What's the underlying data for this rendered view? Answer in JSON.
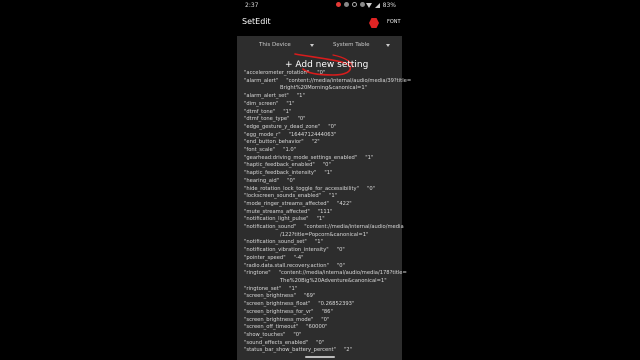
{
  "status_bar": {
    "time": "2:37",
    "battery": "83%"
  },
  "appbar": {
    "title": "SetEdit",
    "font_label": "FONT"
  },
  "dropdowns": {
    "device": "This Device",
    "table": "System Table"
  },
  "add_button": "+ Add new setting",
  "settings": [
    {
      "key": "\"accelerometer_rotation\"",
      "value": "\"0\""
    },
    {
      "key": "\"alarm_alert\"",
      "value": "\"content://media/internal/audio/media/39?title=",
      "cont": "Bright%20Morning&canonical=1\""
    },
    {
      "key": "\"alarm_alert_set\"",
      "value": "\"1\""
    },
    {
      "key": "\"dim_screen\"",
      "value": "\"1\""
    },
    {
      "key": "\"dtmf_tone\"",
      "value": "\"1\""
    },
    {
      "key": "\"dtmf_tone_type\"",
      "value": "\"0\""
    },
    {
      "key": "\"edge_gesture_y_dead_zone\"",
      "value": "\"0\""
    },
    {
      "key": "\"egg_mode_r\"",
      "value": "\"1644712444063\""
    },
    {
      "key": "\"end_button_behavior\"",
      "value": "\"2\""
    },
    {
      "key": "\"font_scale\"",
      "value": "\"1.0\""
    },
    {
      "key": "\"gearhead:driving_mode_settings_enabled\"",
      "value": "\"1\""
    },
    {
      "key": "\"haptic_feedback_enabled\"",
      "value": "\"0\""
    },
    {
      "key": "\"haptic_feedback_intensity\"",
      "value": "\"1\""
    },
    {
      "key": "\"hearing_aid\"",
      "value": "\"0\""
    },
    {
      "key": "\"hide_rotation_lock_toggle_for_accessibility\"",
      "value": "\"0\""
    },
    {
      "key": "\"lockscreen_sounds_enabled\"",
      "value": "\"1\""
    },
    {
      "key": "\"mode_ringer_streams_affected\"",
      "value": "\"422\""
    },
    {
      "key": "\"mute_streams_affected\"",
      "value": "\"111\""
    },
    {
      "key": "\"notification_light_pulse\"",
      "value": "\"1\""
    },
    {
      "key": "\"notification_sound\"",
      "value": "\"content://media/internal/audio/media",
      "cont": "/122?title=Popcorn&canonical=1\""
    },
    {
      "key": "\"notification_sound_set\"",
      "value": "\"1\""
    },
    {
      "key": "\"notification_vibration_intensity\"",
      "value": "\"0\""
    },
    {
      "key": "\"pointer_speed\"",
      "value": "\"-4\""
    },
    {
      "key": "\"radio.data.stall.recovery.action\"",
      "value": "\"0\""
    },
    {
      "key": "\"ringtone\"",
      "value": "\"content://media/internal/audio/media/178?title=",
      "cont": "The%20Big%20Adventure&canonical=1\""
    },
    {
      "key": "\"ringtone_set\"",
      "value": "\"1\""
    },
    {
      "key": "\"screen_brightness\"",
      "value": "\"69\""
    },
    {
      "key": "\"screen_brightness_float\"",
      "value": "\"0.26852393\""
    },
    {
      "key": "\"screen_brightness_for_vr\"",
      "value": "\"86\""
    },
    {
      "key": "\"screen_brightness_mode\"",
      "value": "\"0\""
    },
    {
      "key": "\"screen_off_timeout\"",
      "value": "\"60000\""
    },
    {
      "key": "\"show_touches\"",
      "value": "\"0\""
    },
    {
      "key": "\"sound_effects_enabled\"",
      "value": "\"0\""
    },
    {
      "key": "\"status_bar_show_battery_percent\"",
      "value": "\"2\""
    }
  ],
  "colors": {
    "panel": "#2d2d2d",
    "accent": "#e02424",
    "annotation": "#d81c1c"
  }
}
